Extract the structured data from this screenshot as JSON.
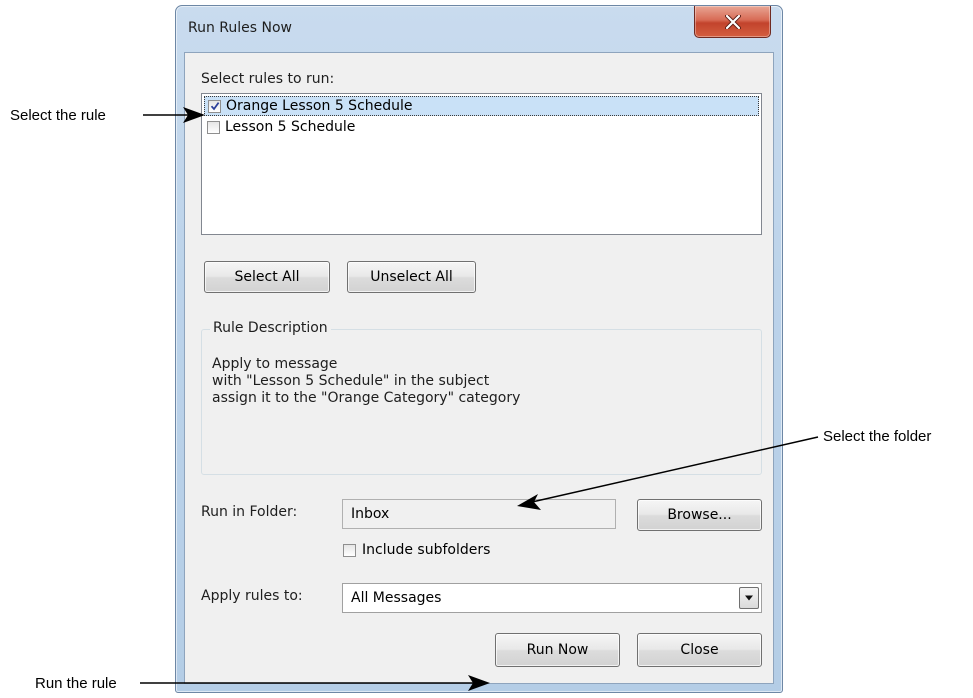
{
  "window": {
    "title": "Run Rules Now"
  },
  "rules": {
    "label": "Select rules to run:",
    "items": [
      {
        "name": "Orange Lesson 5 Schedule",
        "checked": true,
        "selected": true
      },
      {
        "name": "Lesson 5 Schedule",
        "checked": false,
        "selected": false
      }
    ]
  },
  "buttons": {
    "select_all": "Select All",
    "unselect_all": "Unselect All",
    "browse": "Browse...",
    "run_now": "Run Now",
    "close": "Close"
  },
  "description": {
    "legend": "Rule Description",
    "lines": [
      "Apply to message",
      "with \"Lesson 5 Schedule\" in the subject",
      "assign it to the \"Orange Category\" category"
    ]
  },
  "folder": {
    "label": "Run in Folder:",
    "value": "Inbox",
    "include_subfolders_label": "Include subfolders",
    "include_subfolders": false
  },
  "apply": {
    "label": "Apply rules to:",
    "selected": "All Messages"
  },
  "callouts": {
    "select_rule": "Select the rule",
    "select_folder": "Select the folder",
    "run_rule": "Run the rule"
  },
  "colors": {
    "selection": "#c9e1f7",
    "close_button": "#c2432c",
    "window_frame": "#bcd3ea"
  }
}
